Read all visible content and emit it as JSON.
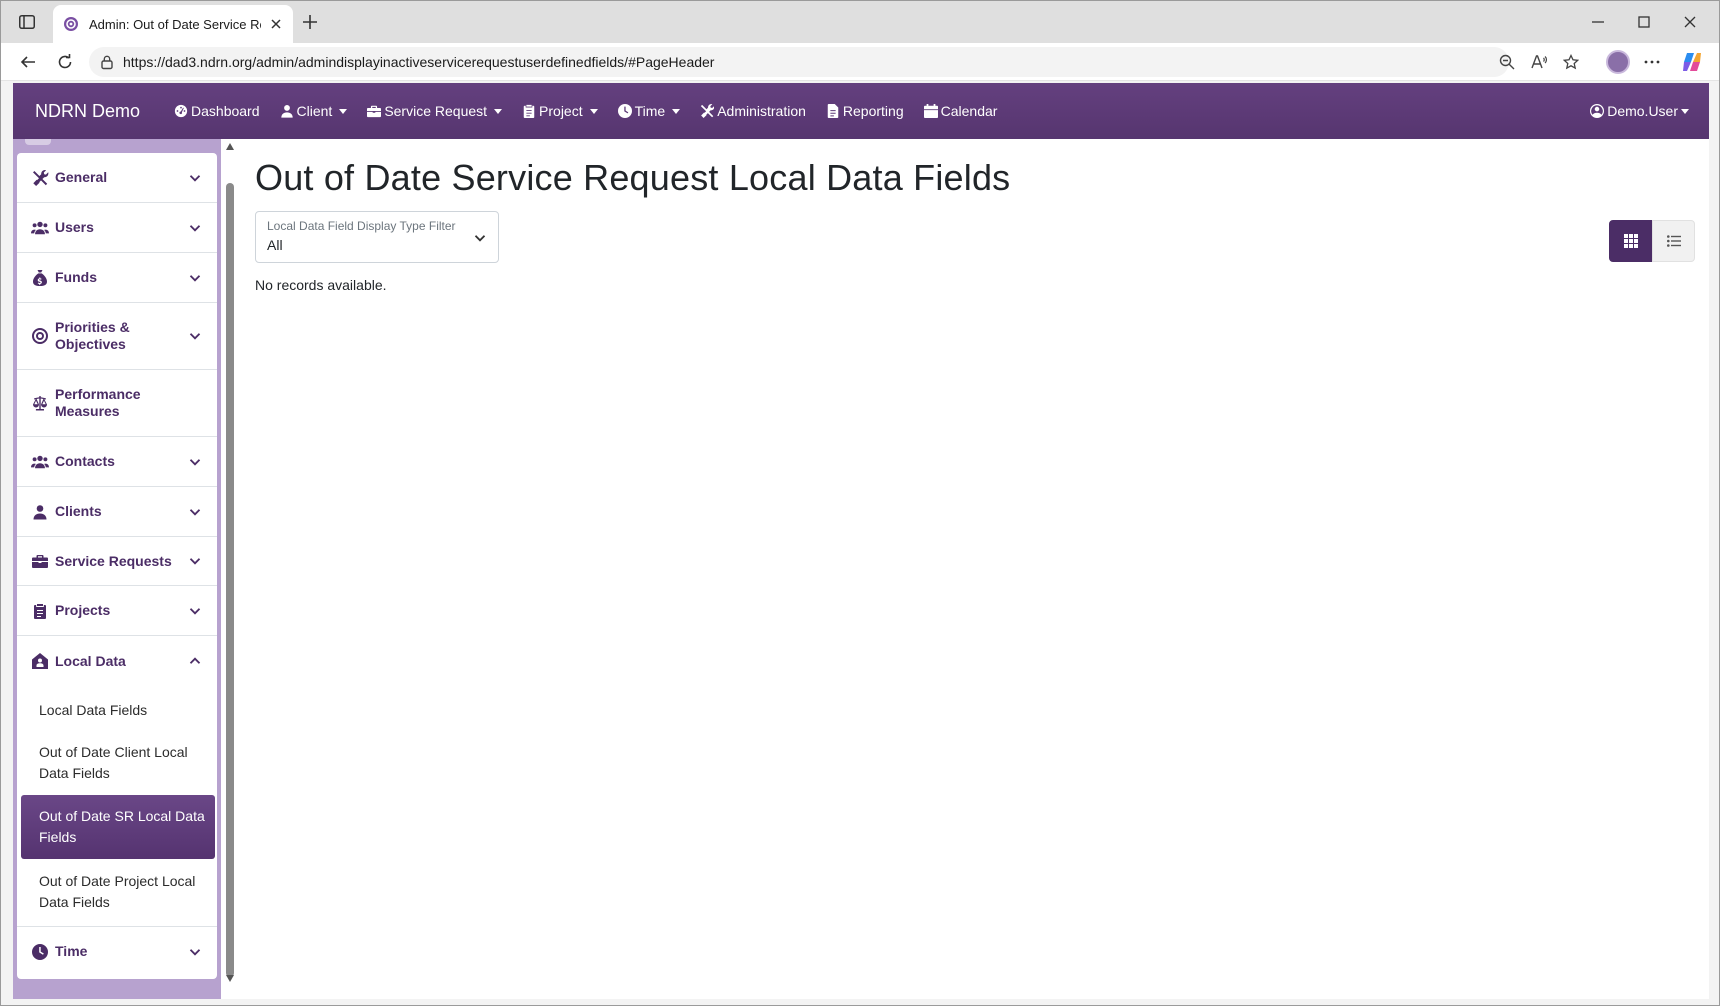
{
  "browser": {
    "tab_title": "Admin: Out of Date Service Requ",
    "url": "https://dad3.ndrn.org/admin/admindisplayinactiveservicerequestuserdefinedfields/#PageHeader"
  },
  "topnav": {
    "brand": "NDRN Demo",
    "items": [
      {
        "label": "Dashboard",
        "icon": "gauge-icon",
        "dropdown": false
      },
      {
        "label": "Client",
        "icon": "person-icon",
        "dropdown": true
      },
      {
        "label": "Service Request",
        "icon": "briefcase-icon",
        "dropdown": true
      },
      {
        "label": "Project",
        "icon": "clipboard-icon",
        "dropdown": true
      },
      {
        "label": "Time",
        "icon": "clock-icon",
        "dropdown": true
      },
      {
        "label": "Administration",
        "icon": "tools-icon",
        "dropdown": false
      },
      {
        "label": "Reporting",
        "icon": "file-icon",
        "dropdown": false
      },
      {
        "label": "Calendar",
        "icon": "calendar-icon",
        "dropdown": false
      }
    ],
    "user": "Demo.User"
  },
  "sidebar": {
    "items": [
      {
        "label": "General",
        "icon": "tools-icon",
        "expanded": false
      },
      {
        "label": "Users",
        "icon": "users-icon",
        "expanded": false
      },
      {
        "label": "Funds",
        "icon": "money-bag-icon",
        "expanded": false
      },
      {
        "label": "Priorities & Objectives",
        "icon": "target-icon",
        "expanded": false
      },
      {
        "label": "Performance Measures",
        "icon": "scale-icon"
      },
      {
        "label": "Contacts",
        "icon": "users-icon",
        "expanded": false
      },
      {
        "label": "Clients",
        "icon": "person-icon",
        "expanded": false
      },
      {
        "label": "Service Requests",
        "icon": "briefcase-icon",
        "expanded": false
      },
      {
        "label": "Projects",
        "icon": "clipboard-icon",
        "expanded": false
      },
      {
        "label": "Local Data",
        "icon": "house-icon",
        "expanded": true
      },
      {
        "label": "Time",
        "icon": "clock-icon",
        "expanded": false
      }
    ],
    "local_data_children": [
      {
        "label": "Local Data Fields",
        "active": false
      },
      {
        "label": "Out of Date Client Local Data Fields",
        "active": false
      },
      {
        "label": "Out of Date SR Local Data Fields",
        "active": true
      },
      {
        "label": "Out of Date Project Local Data Fields",
        "active": false
      }
    ]
  },
  "main": {
    "title": "Out of Date Service Request Local Data Fields",
    "filter": {
      "label": "Local Data Field Display Type Filter",
      "value": "All"
    },
    "empty_message": "No records available.",
    "view_toggle": {
      "active": "grid"
    }
  },
  "colors": {
    "brand_purple": "#5a3875",
    "sidebar_text": "#4b2d66",
    "sidebar_frame": "#b7a2cf"
  }
}
